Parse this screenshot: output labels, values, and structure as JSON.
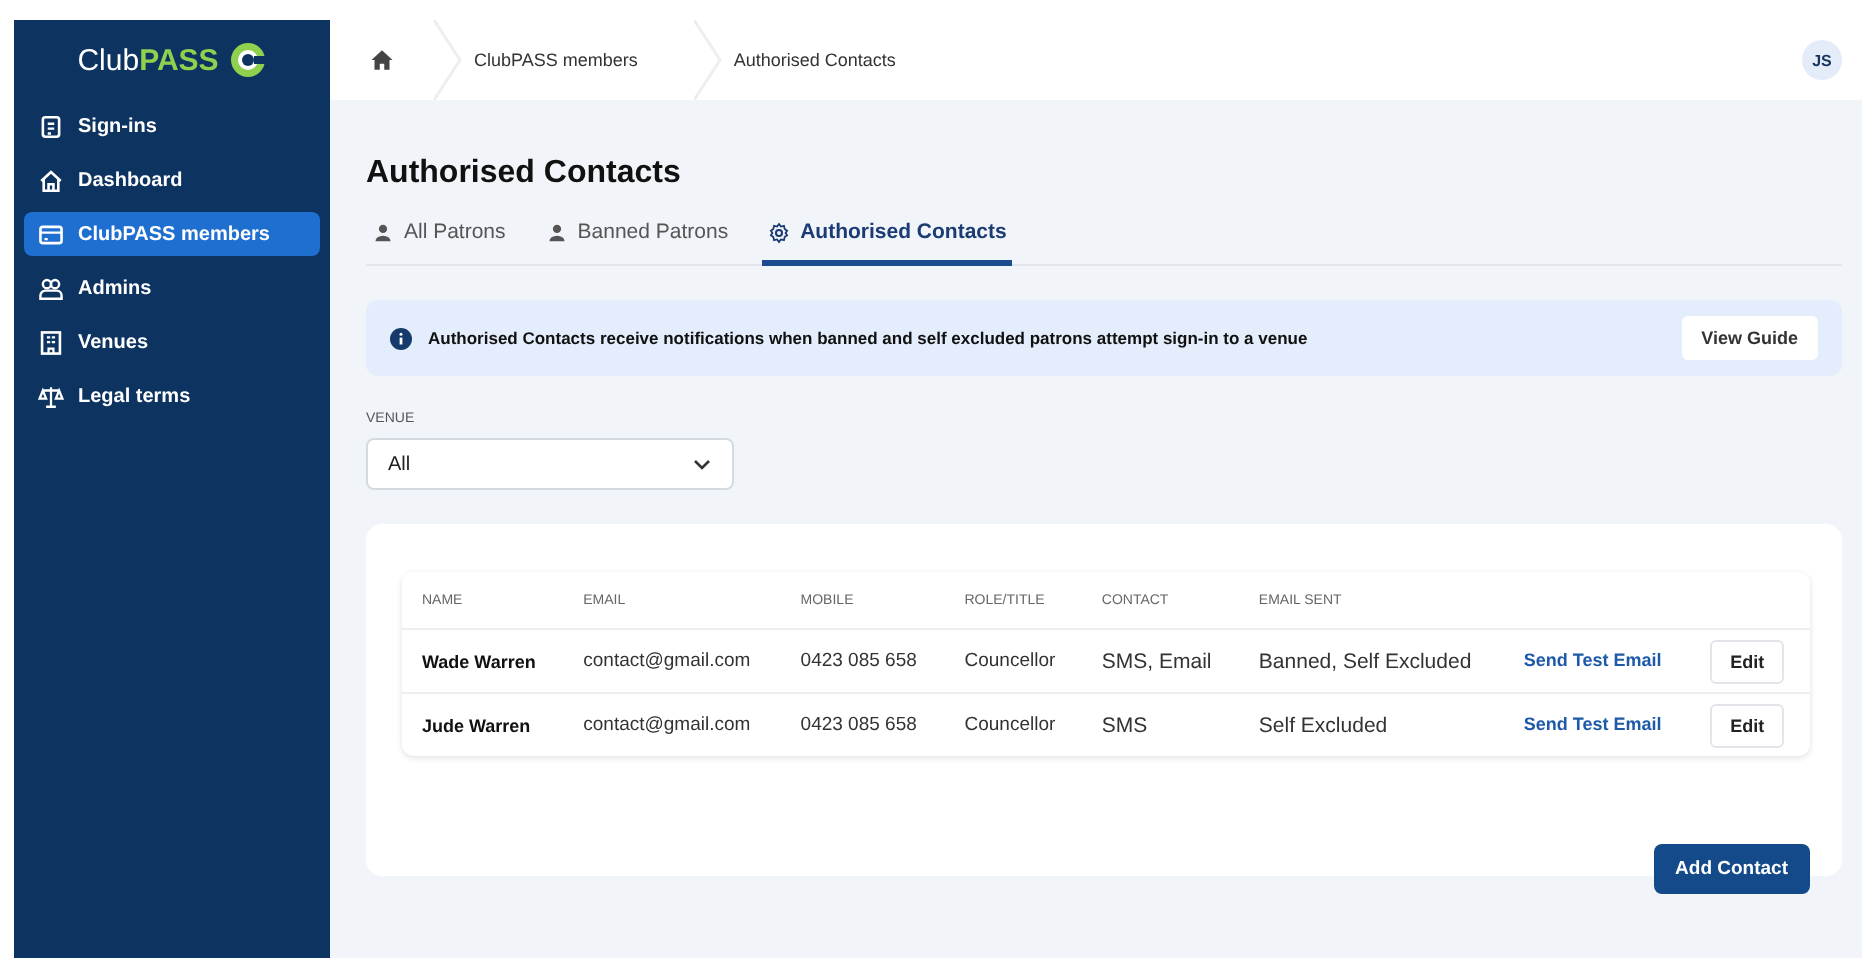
{
  "logo": {
    "text": "Club**PASS**"
  },
  "sidebar": {
    "items": [
      {
        "label": "Sign-ins",
        "selected": false
      },
      {
        "label": "Dashboard",
        "selected": false
      },
      {
        "label": "ClubPASS members",
        "selected": true
      },
      {
        "label": "Admins",
        "selected": false
      },
      {
        "label": "Venues",
        "selected": false
      },
      {
        "label": "Legal terms",
        "selected": false
      }
    ]
  },
  "breadcrumb": [
    "ClubPASS members",
    "Authorised Contacts"
  ],
  "avatar": "JS",
  "title": "Authorised Contacts",
  "tabs": [
    {
      "label": "All Patrons",
      "selected": false
    },
    {
      "label": "Banned Patrons",
      "selected": false
    },
    {
      "label": "Authorised Contacts",
      "selected": true
    }
  ],
  "banner": {
    "text": "Authorised Contacts receive notifications when banned and self excluded patrons attempt sign-in to a venue",
    "button": "View Guide"
  },
  "venue": {
    "label": "VENUE",
    "value": "All"
  },
  "table": {
    "columns": [
      "NAME",
      "EMAIL",
      "MOBILE",
      "ROLE/TITLE",
      "CONTACT",
      "EMAIL SENT"
    ],
    "rows": [
      {
        "cells": [
          "Wade Warren",
          "contact@gmail.com",
          "0423 085 658",
          "Councellor",
          "SMS, Email",
          "Banned, Self Excluded"
        ],
        "link": "Send Test Email",
        "button": "Edit"
      },
      {
        "cells": [
          "Jude Warren",
          "contact@gmail.com",
          "0423 085 658",
          "Councellor",
          "SMS",
          "Self Excluded"
        ],
        "link": "Send Test Email",
        "button": "Edit"
      }
    ]
  },
  "add_button": "Add Contact"
}
